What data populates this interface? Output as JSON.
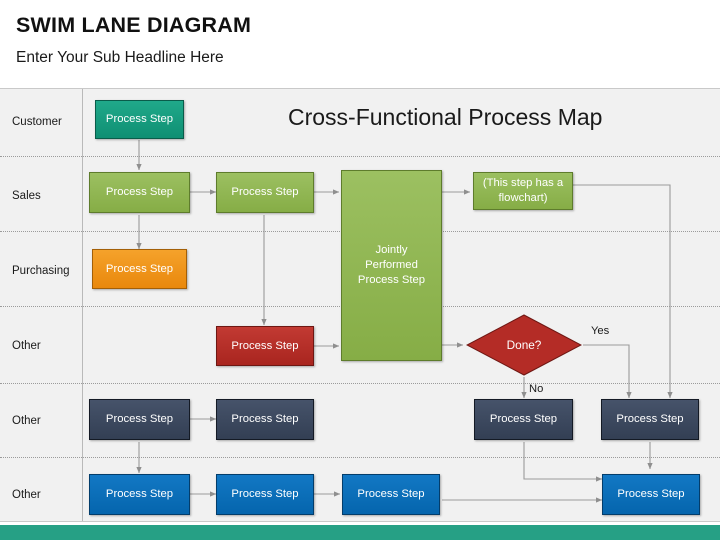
{
  "header": {
    "title": "SWIM LANE DIAGRAM",
    "subtitle": "Enter Your Sub Headline Here"
  },
  "diagram": {
    "map_title": "Cross-Functional Process Map",
    "lanes": [
      {
        "label": "Customer"
      },
      {
        "label": "Sales"
      },
      {
        "label": "Purchasing"
      },
      {
        "label": "Other"
      },
      {
        "label": "Other"
      },
      {
        "label": "Other"
      }
    ],
    "nodes": [
      {
        "id": "n1",
        "label": "Process Step",
        "lane": "Customer",
        "color": "#17a184"
      },
      {
        "id": "n2",
        "label": "Process Step",
        "lane": "Sales",
        "color": "#90b755"
      },
      {
        "id": "n3",
        "label": "Process Step",
        "lane": "Sales",
        "color": "#90b755"
      },
      {
        "id": "n4",
        "label": "(This step has a flowchart)",
        "lane": "Sales",
        "color": "#90b755"
      },
      {
        "id": "n5",
        "label": "Jointly Performed Process Step",
        "lane": "Sales-Other",
        "color": "#90b755"
      },
      {
        "id": "n6",
        "label": "Process Step",
        "lane": "Purchasing",
        "color": "#ef9019"
      },
      {
        "id": "n7",
        "label": "Process Step",
        "lane": "Other",
        "color": "#b42c26"
      },
      {
        "id": "n8",
        "label": "Done?",
        "lane": "Other",
        "color": "#b42c26",
        "shape": "decision"
      },
      {
        "id": "n9",
        "label": "Process Step",
        "lane": "Other2",
        "color": "#3b4757"
      },
      {
        "id": "n10",
        "label": "Process Step",
        "lane": "Other2",
        "color": "#3b4757"
      },
      {
        "id": "n11",
        "label": "Process Step",
        "lane": "Other2",
        "color": "#3b4757"
      },
      {
        "id": "n12",
        "label": "Process Step",
        "lane": "Other2",
        "color": "#3b4757"
      },
      {
        "id": "n13",
        "label": "Process Step",
        "lane": "Other3",
        "color": "#0a6cb5"
      },
      {
        "id": "n14",
        "label": "Process Step",
        "lane": "Other3",
        "color": "#0a6cb5"
      },
      {
        "id": "n15",
        "label": "Process Step",
        "lane": "Other3",
        "color": "#0a6cb5"
      },
      {
        "id": "n16",
        "label": "Process Step",
        "lane": "Other3",
        "color": "#0a6cb5"
      }
    ],
    "edge_labels": {
      "yes": "Yes",
      "no": "No"
    },
    "colors": {
      "teal": "#17a184",
      "green": "#90b755",
      "orange": "#ef9019",
      "red": "#b42c26",
      "navy": "#3b4757",
      "blue": "#0a6cb5",
      "lane_bg": "#f1f1f1",
      "accent_bar": "#26a085",
      "connector": "#9a9a9a"
    }
  }
}
